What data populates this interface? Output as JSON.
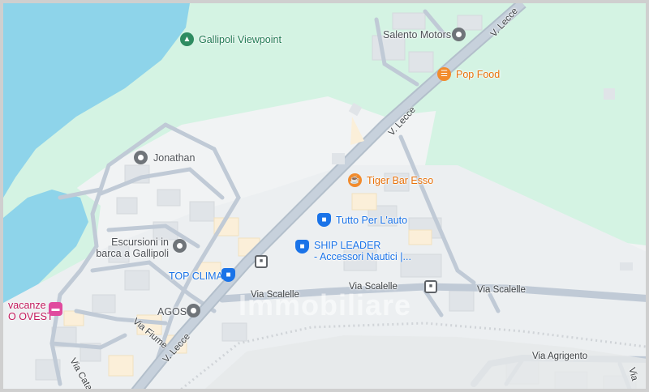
{
  "places": {
    "gallipoli_viewpoint": "Gallipoli Viewpoint",
    "salento_motors": "Salento Motors",
    "pop_food": "Pop Food",
    "jonathan": "Jonathan",
    "tiger_bar": "Tiger Bar Esso",
    "tutto_per_lauto": "Tutto Per L'auto",
    "ship_leader_line1": "SHIP LEADER",
    "ship_leader_line2": "- Accessori Nautici |...",
    "escursioni_line1": "Escursioni in",
    "escursioni_line2": "barca a Gallipoli",
    "top_clima": "TOP CLIMA",
    "agos": "AGOS",
    "vacanze_line1": "vacanze",
    "vacanze_line2": "O OVEST"
  },
  "roads": {
    "v_lecce_top": "V. Lecce",
    "v_lecce_mid": "V. Lecce",
    "v_lecce_bottom": "V. Lecce",
    "via_scalelle_1": "Via Scalelle",
    "via_scalelle_2": "Via Scalelle",
    "via_scalelle_3": "Via Scalelle",
    "via_fiume": "Via Fiume",
    "via_agrigento": "Via Agrigento",
    "via_catan": "Via Catan",
    "via_v": "Via"
  },
  "watermark": "Immobiliare",
  "icons": {
    "viewpoint": "park-icon",
    "generic": "place-pin-icon",
    "food": "restaurant-icon",
    "cafe": "cafe-icon",
    "shop": "shopping-bag-icon",
    "hotel": "hotel-icon",
    "bus": "bus-stop-icon"
  },
  "colors": {
    "water": "#8ed4ea",
    "park": "#d4f3e3",
    "land": "#f1f3f4",
    "road": "#c0cad6",
    "building": "#e0e4e8",
    "building_alt": "#fbefd9"
  }
}
